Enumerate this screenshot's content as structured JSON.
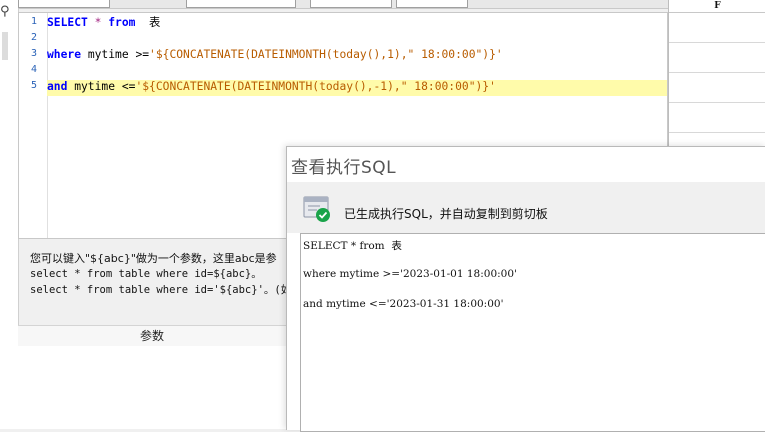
{
  "editor": {
    "line_numbers": [
      "1",
      "2",
      "3",
      "4",
      "5"
    ],
    "lines": [
      {
        "kw": "SELECT",
        "op": " * ",
        "kw2": "from",
        "rest": "  表"
      },
      {
        "plain": ""
      },
      {
        "kw": "where",
        "rest": " mytime ",
        "op": ">=",
        "str": "'${CONCATENATE(DATEINMONTH(today(),1),\" 18:00:00\")}'"
      },
      {
        "plain": ""
      },
      {
        "kw": "and",
        "rest": " mytime ",
        "op": "<=",
        "str": "'${CONCATENATE(DATEINMONTH(today(),-1),\" 18:00:00\")}'"
      }
    ]
  },
  "hint": {
    "line1": "您可以键入\"${abc}\"做为一个参数，这里abc是参",
    "line2": "select * from table where id=${abc}。",
    "line3": "select * from table where id='${abc}'。(如果"
  },
  "params": {
    "header": "参数"
  },
  "grid": {
    "column": "F"
  },
  "dialog": {
    "title": "查看执行SQL",
    "message": "已生成执行SQL，并自动复制到剪切板",
    "sql_lines": [
      "SELECT * from  表",
      "where mytime >='2023-01-01 18:00:00'",
      "and mytime <='2023-01-31 18:00:00'"
    ]
  },
  "colors": {
    "keyword": "#0000ff",
    "highlight": "#fffbaa",
    "string": "#b85c00",
    "success": "#1aa34a"
  }
}
